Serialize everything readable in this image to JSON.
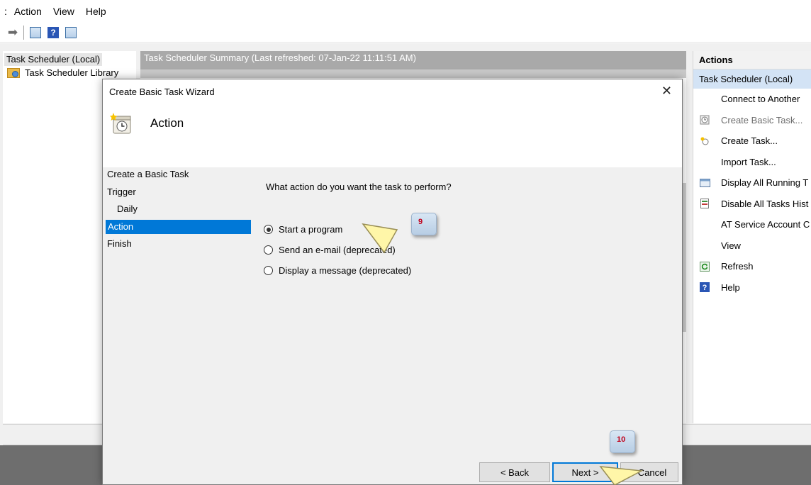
{
  "menubar": {
    "cut_item": ":",
    "items": [
      "Action",
      "View",
      "Help"
    ]
  },
  "toolbar": {
    "icons": [
      "forward-arrow-icon",
      "show-hide-console-tree-icon",
      "help-icon",
      "show-hide-action-pane-icon"
    ]
  },
  "tree": {
    "root": "Task Scheduler (Local)",
    "library": "Task Scheduler Library"
  },
  "summary": {
    "header": "Task Scheduler Summary (Last refreshed: 07-Jan-22 11:11:51 AM)"
  },
  "actions_pane": {
    "title": "Actions",
    "section": "Task Scheduler (Local)",
    "items": [
      {
        "label": "Connect to Another",
        "icon": "",
        "disabled": false
      },
      {
        "label": "Create Basic Task...",
        "icon": "create-basic-task-icon",
        "disabled": true
      },
      {
        "label": "Create Task...",
        "icon": "create-task-icon",
        "disabled": false
      },
      {
        "label": "Import Task...",
        "icon": "",
        "disabled": false
      },
      {
        "label": "Display All Running T",
        "icon": "display-running-tasks-icon",
        "disabled": false
      },
      {
        "label": "Disable All Tasks Hist",
        "icon": "disable-history-icon",
        "disabled": false
      },
      {
        "label": "AT Service Account C",
        "icon": "",
        "disabled": false
      },
      {
        "label": "View",
        "icon": "",
        "disabled": false
      },
      {
        "label": "Refresh",
        "icon": "refresh-icon",
        "disabled": false
      },
      {
        "label": "Help",
        "icon": "help-icon",
        "disabled": false
      }
    ]
  },
  "wizard": {
    "title": "Create Basic Task Wizard",
    "close": "✕",
    "header_title": "Action",
    "steps": [
      "Create a Basic Task",
      "Trigger",
      "Daily",
      "Action",
      "Finish"
    ],
    "question": "What action do you want the task to perform?",
    "options": [
      {
        "label": "Start a program",
        "checked": true
      },
      {
        "label": "Send an e-mail (deprecated)",
        "checked": false
      },
      {
        "label": "Display a message (deprecated)",
        "checked": false
      }
    ],
    "buttons": {
      "back": "< Back",
      "next": "Next >",
      "cancel": "Cancel"
    }
  },
  "callouts": {
    "first": "9",
    "second": "10"
  },
  "colors": {
    "selection": "#0078d7",
    "callout_text": "#c0001a"
  }
}
